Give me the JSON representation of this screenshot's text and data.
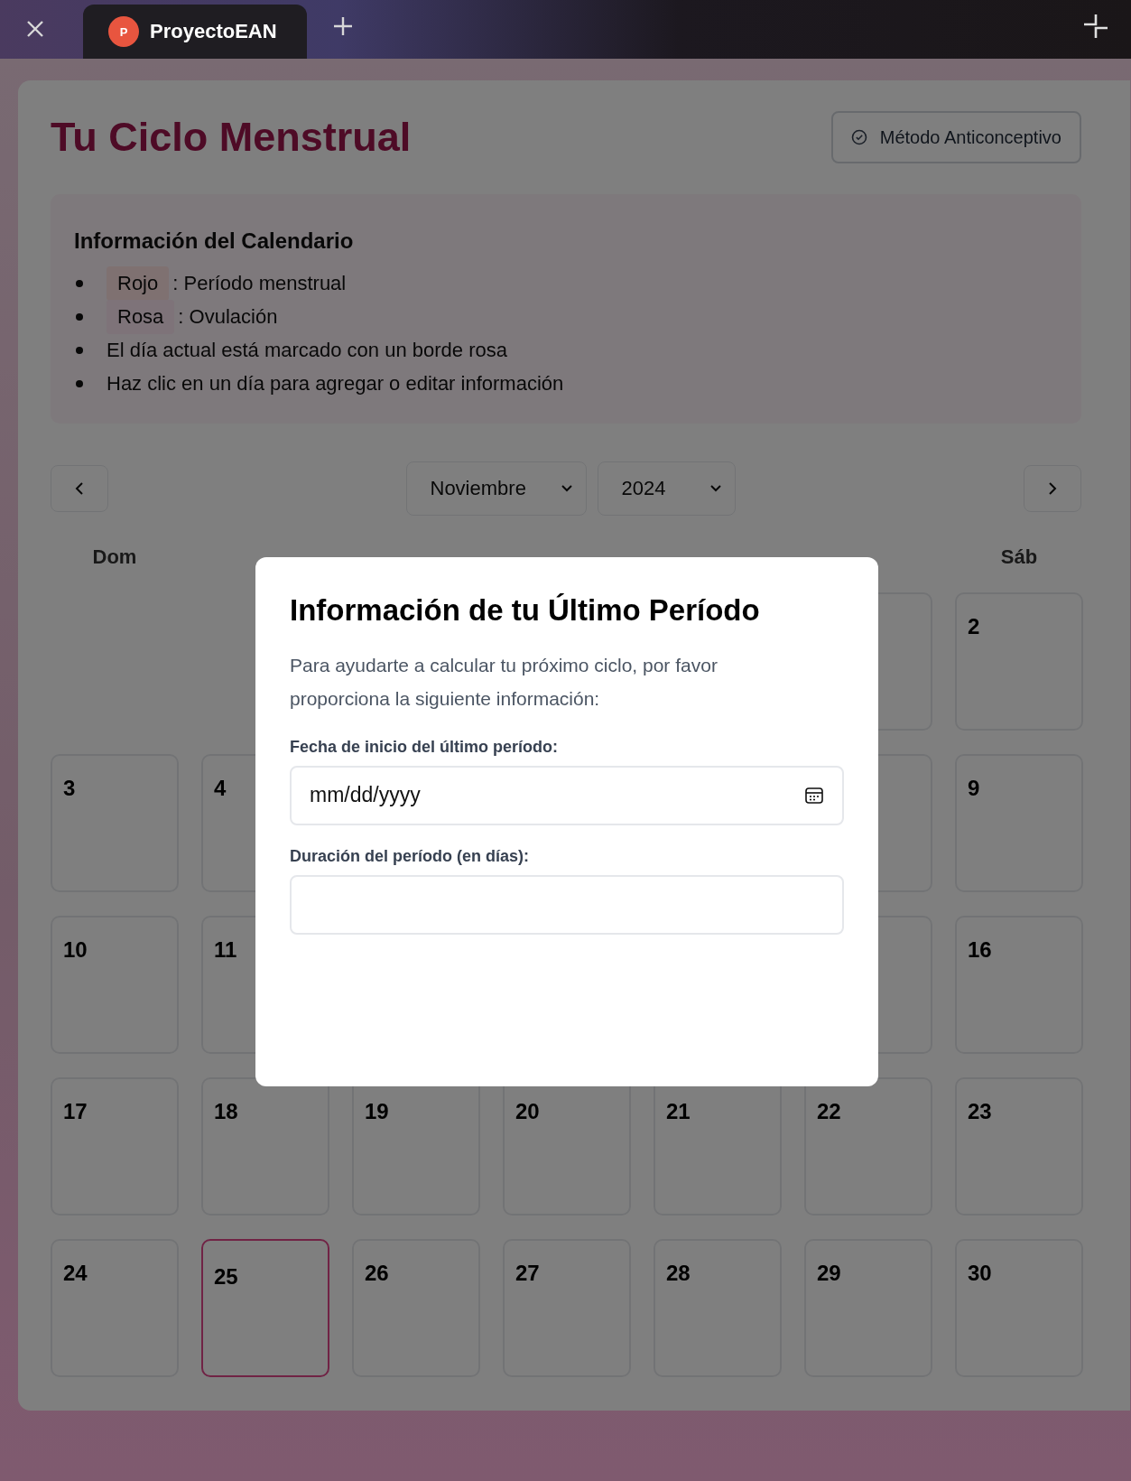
{
  "browser": {
    "tab": {
      "title": "ProyectoEAN",
      "avatar": "P",
      "selected": true
    }
  },
  "page": {
    "title": "Tu Ciclo Menstrual",
    "contraception_button": "Método Anticonceptivo"
  },
  "legend": {
    "title": "Información del Calendario",
    "items": [
      {
        "kind": "swatch",
        "label": "Rojo",
        "color": "#7f7171",
        "text": ": Período menstrual"
      },
      {
        "kind": "swatch",
        "label": "Rosa",
        "color": "#7e7379",
        "text": ": Ovulación"
      },
      {
        "kind": "text",
        "text": "El día actual está marcado con un borde rosa"
      },
      {
        "kind": "text",
        "text": "Haz clic en un día para agregar o editar información"
      }
    ]
  },
  "calendar": {
    "month": "Noviembre",
    "year": "2024",
    "weekdays": [
      {
        "kind": "label",
        "text": "Dom"
      },
      {
        "kind": "covered"
      },
      {
        "kind": "covered"
      },
      {
        "kind": "covered"
      },
      {
        "kind": "covered"
      },
      {
        "kind": "covered"
      },
      {
        "kind": "label",
        "text": "Sáb"
      }
    ],
    "weeks": [
      [
        {
          "kind": "empty"
        },
        {
          "kind": "empty"
        },
        {
          "kind": "empty"
        },
        {
          "kind": "empty"
        },
        {
          "kind": "empty"
        },
        {
          "kind": "day",
          "today": false
        },
        {
          "kind": "day",
          "day": "2",
          "today": false
        }
      ],
      [
        {
          "kind": "day",
          "day": "3",
          "today": false
        },
        {
          "kind": "day",
          "day": "4",
          "today": false
        },
        {
          "kind": "covered"
        },
        {
          "kind": "covered"
        },
        {
          "kind": "covered"
        },
        {
          "kind": "day",
          "today": false
        },
        {
          "kind": "day",
          "day": "9",
          "today": false
        }
      ],
      [
        {
          "kind": "day",
          "day": "10",
          "today": false
        },
        {
          "kind": "day",
          "day": "11",
          "today": false
        },
        {
          "kind": "covered"
        },
        {
          "kind": "covered"
        },
        {
          "kind": "covered"
        },
        {
          "kind": "day",
          "today": false
        },
        {
          "kind": "day",
          "day": "16",
          "today": false
        }
      ],
      [
        {
          "kind": "day",
          "day": "17",
          "today": false
        },
        {
          "kind": "day",
          "day": "18",
          "today": false
        },
        {
          "kind": "day",
          "day": "19",
          "today": false
        },
        {
          "kind": "day",
          "day": "20",
          "today": false
        },
        {
          "kind": "day",
          "day": "21",
          "today": false
        },
        {
          "kind": "day",
          "day": "22",
          "today": false
        },
        {
          "kind": "day",
          "day": "23",
          "today": false
        }
      ],
      [
        {
          "kind": "day",
          "day": "24",
          "today": false
        },
        {
          "kind": "day",
          "day": "25",
          "today": true
        },
        {
          "kind": "day",
          "day": "26",
          "today": false
        },
        {
          "kind": "day",
          "day": "27",
          "today": false
        },
        {
          "kind": "day",
          "day": "28",
          "today": false
        },
        {
          "kind": "day",
          "day": "29",
          "today": false
        },
        {
          "kind": "day",
          "day": "30",
          "today": false
        }
      ]
    ]
  },
  "modal": {
    "title": "Información de tu Último Período",
    "text": "Para ayudarte a calcular tu próximo ciclo, por favor proporciona la siguiente información:",
    "fields": [
      {
        "kind": "date",
        "label": "Fecha de inicio del último período:",
        "placeholder": "mm/dd/yyyy"
      },
      {
        "kind": "number",
        "label": "Duración del período (en días):"
      }
    ]
  }
}
